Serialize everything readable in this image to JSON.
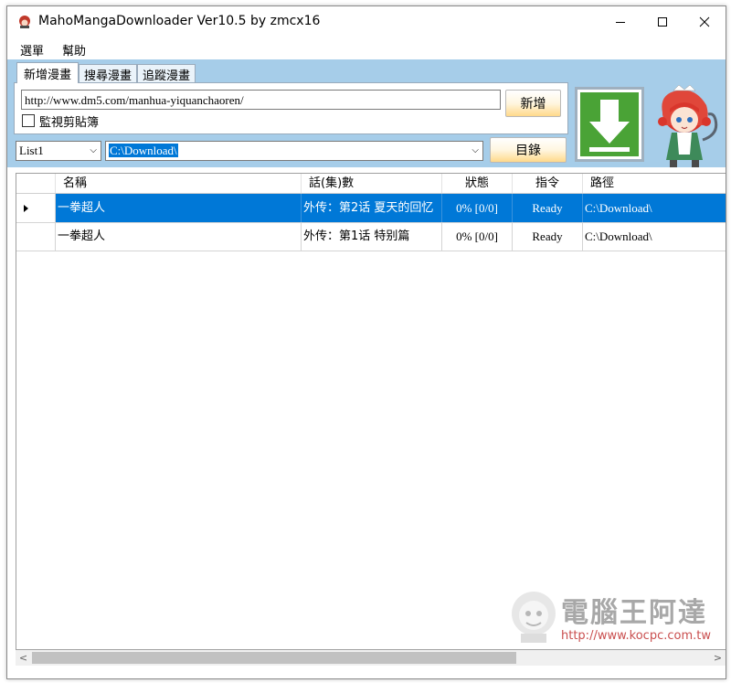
{
  "window": {
    "title": "MahoMangaDownloader Ver10.5 by zmcx16"
  },
  "menu": [
    "選單",
    "幫助"
  ],
  "tabs": [
    {
      "label": "新增漫畫",
      "active": true
    },
    {
      "label": "搜尋漫畫",
      "active": false
    },
    {
      "label": "追蹤漫畫",
      "active": false
    }
  ],
  "add": {
    "url_value": "http://www.dm5.com/manhua-yiquanchaoren/",
    "add_button": "新增",
    "monitor_clipboard_label": "監視剪貼簿",
    "monitor_clipboard_checked": false
  },
  "path": {
    "list_value": "List1",
    "dir_value": "C:\\Download\\",
    "dir_button": "目錄"
  },
  "grid": {
    "columns": [
      "名稱",
      "話(集)數",
      "狀態",
      "指令",
      "路徑"
    ],
    "rows": [
      {
        "name": "一拳超人",
        "episode": "外传：第2话 夏天的回忆",
        "status": "0% [0/0]",
        "command": "Ready",
        "path": "C:\\Download\\",
        "selected": true
      },
      {
        "name": "一拳超人",
        "episode": "外传：第1话 特别篇",
        "status": "0% [0/0]",
        "command": "Ready",
        "path": "C:\\Download\\",
        "selected": false
      }
    ]
  },
  "watermark": {
    "text": "電腦王阿達",
    "url": "http://www.kocpc.com.tw"
  },
  "colors": {
    "accent": "#0078d7",
    "panel": "#a6cde9",
    "download_green": "#4aa336"
  },
  "icons": [
    "app-icon",
    "minimize-icon",
    "maximize-icon",
    "close-icon",
    "download-arrow-icon",
    "chevron-down-icon",
    "row-pointer-icon",
    "scroll-left-icon",
    "scroll-right-icon"
  ]
}
